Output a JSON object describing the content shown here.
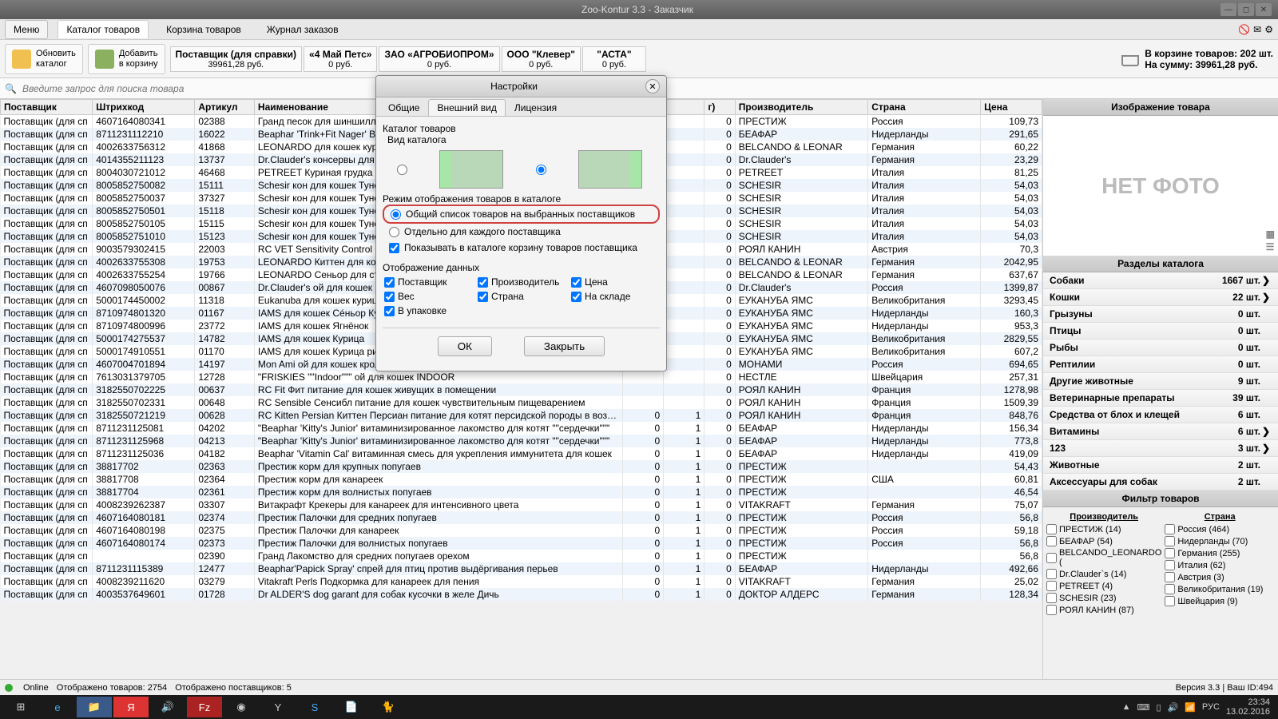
{
  "titlebar": {
    "title": "Zoo-Kontur 3.3 - Заказчик"
  },
  "menu": {
    "button": "Меню",
    "tabs": [
      "Каталог товаров",
      "Корзина товаров",
      "Журнал заказов"
    ]
  },
  "toolbar": {
    "refresh": "Обновить\nкаталог",
    "add": "Добавить\nв корзину",
    "suppliers": [
      {
        "name": "Поставщик (для справки)",
        "value": "39961,28 руб."
      },
      {
        "name": "«4 Май Петс»",
        "value": "0 руб."
      },
      {
        "name": "ЗАО «АГРОБИОПРОМ»",
        "value": "0 руб."
      },
      {
        "name": "ООО \"Клевер\"",
        "value": "0 руб."
      },
      {
        "name": "\"АСТА\"",
        "value": "0 руб."
      }
    ],
    "cart_items": "В корзине товаров: 202 шт.",
    "cart_sum": "На сумму: 39961,28 руб."
  },
  "search": {
    "placeholder": "Введите запрос для поиска товара"
  },
  "columns": [
    "Поставщик",
    "Штрихкод",
    "Артикул",
    "Наименование",
    "",
    "",
    "",
    "Производитель",
    "Страна",
    "Цена"
  ],
  "col_extra_g": "г)",
  "rows": [
    [
      "Поставщик (для сп",
      "4607164080341",
      "02388",
      "Гранд песок для шиншилл",
      "",
      "",
      "0",
      "ПРЕСТИЖ",
      "Россия",
      "109,73"
    ],
    [
      "Поставщик (для сп",
      "8711231112210",
      "16022",
      "Beaphar 'Trink+Fit Nager' Витамины для грызунов",
      "",
      "",
      "0",
      "БЕАФАР",
      "Нидерланды",
      "291,65"
    ],
    [
      "Поставщик (для сп",
      "4002633756312",
      "41868",
      "LEONARDO для кошек курицей",
      "",
      "",
      "0",
      "BELCANDO & LEONAR",
      "Германия",
      "60,22"
    ],
    [
      "Поставщик (для сп",
      "4014355211123",
      "13737",
      "Dr.Clauder's консервы для кошек вида Домашняя",
      "",
      "",
      "0",
      "Dr.Clauder's",
      "Германия",
      "23,29"
    ],
    [
      "Поставщик (для сп",
      "8004030721012",
      "46468",
      "PETREET Куриная грудка",
      "",
      "",
      "0",
      "PETREET",
      "Италия",
      "81,25"
    ],
    [
      "Поставщик (для сп",
      "8005852750082",
      "15111",
      "Schesir кон для кошек Тунец морскими водорослями",
      "",
      "",
      "0",
      "SCHESIR",
      "Италия",
      "54,03"
    ],
    [
      "Поставщик (для сп",
      "8005852750037",
      "37327",
      "Schesir кон для кошек Тунец Мальки",
      "",
      "",
      "0",
      "SCHESIR",
      "Италия",
      "54,03"
    ],
    [
      "Поставщик (для сп",
      "8005852750501",
      "15118",
      "Schesir кон для кошек Тунец и курицей в собственном соку",
      "",
      "",
      "0",
      "SCHESIR",
      "Италия",
      "54,03"
    ],
    [
      "Поставщик (для сп",
      "8005852750105",
      "15115",
      "Schesir кон для кошек Тунец в собственном соку",
      "",
      "",
      "0",
      "SCHESIR",
      "Италия",
      "54,03"
    ],
    [
      "Поставщик (для сп",
      "8005852751010",
      "15123",
      "Schesir кон для кошек Тунец",
      "",
      "",
      "0",
      "SCHESIR",
      "Италия",
      "54,03"
    ],
    [
      "Поставщик (для сп",
      "9003579302415",
      "22003",
      "RC VET Sensitivity Control Сенситив контроль",
      "",
      "",
      "0",
      "РОЯЛ КАНИН",
      "Австрия",
      "70,3"
    ],
    [
      "Поставщик (для сп",
      "4002633755308",
      "19753",
      "LEONARDO Киттен для котят для беременных",
      "",
      "",
      "0",
      "BELCANDO & LEONAR",
      "Германия",
      "2042,95"
    ],
    [
      "Поставщик (для сп",
      "4002633755254",
      "19766",
      "LEONARDO Сеньор для стареющих кошек",
      "",
      "",
      "0",
      "BELCANDO & LEONAR",
      "Германия",
      "637,67"
    ],
    [
      "Поставщик (для сп",
      "4607098050076",
      "00867",
      "Dr.Clauder's ой для кошек Мясное Ассорти",
      "",
      "",
      "0",
      "Dr.Clauder's",
      "Россия",
      "1399,87"
    ],
    [
      "Поставщик (для сп",
      "5000174450002",
      "11318",
      "Eukanuba для кошек курицей и ливер",
      "",
      "",
      "0",
      "ЕУКАНУБА ЯМС",
      "Великобритания",
      "3293,45"
    ],
    [
      "Поставщик (для сп",
      "8710974801320",
      "01167",
      "IAMS для кошек Сéньор Курица рисом",
      "",
      "",
      "0",
      "ЕУКАНУБА ЯМС",
      "Нидерланды",
      "160,3"
    ],
    [
      "Поставщик (для сп",
      "8710974800996",
      "23772",
      "IAMS для кошек Ягнёнок",
      "",
      "",
      "0",
      "ЕУКАНУБА ЯМС",
      "Нидерланды",
      "953,3"
    ],
    [
      "Поставщик (для сп",
      "5000174275537",
      "14782",
      "IAMS для кошек Курица",
      "",
      "",
      "0",
      "ЕУКАНУБА ЯМС",
      "Великобритания",
      "2829,55"
    ],
    [
      "Поставщик (для сп",
      "5000174910551",
      "01170",
      "IAMS для кошек Курица рисом",
      "",
      "",
      "0",
      "ЕУКАНУБА ЯМС",
      "Великобритания",
      "607,2"
    ],
    [
      "Поставщик (для сп",
      "4607004701894",
      "14197",
      "Mon Ami ой для кошек кролик МКБ",
      "",
      "",
      "0",
      "МОНАМИ",
      "Россия",
      "694,65"
    ],
    [
      "Поставщик (для сп",
      "7613031379705",
      "12728",
      "\"FRISKIES \"\"Indoor\"\"\" ой для кошек INDOOR",
      "",
      "",
      "0",
      "НЕСТЛЕ",
      "Швейцария",
      "257,31"
    ],
    [
      "Поставщик (для сп",
      "3182550702225",
      "00637",
      "RC Fit Фит питание для кошек живущих в помещении",
      "",
      "",
      "0",
      "РОЯЛ КАНИН",
      "Франция",
      "1278,98"
    ],
    [
      "Поставщик (для сп",
      "3182550702331",
      "00648",
      "RC Sensible Сенсибл питание для кошек чувствительным пищеварением",
      "",
      "",
      "0",
      "РОЯЛ КАНИН",
      "Франция",
      "1509,39"
    ],
    [
      "Поставщик (для сп",
      "3182550721219",
      "00628",
      "RC Kitten Persian Киттен Персиан питание для котят персидской породы в возрасте",
      "0",
      "1",
      "0",
      "РОЯЛ КАНИН",
      "Франция",
      "848,76"
    ],
    [
      "Поставщик (для сп",
      "8711231125081",
      "04202",
      "\"Beaphar 'Kitty's Junior' витаминизированное лакомство для котят \"\"сердечки\"\"\"",
      "0",
      "1",
      "0",
      "БЕАФАР",
      "Нидерланды",
      "156,34"
    ],
    [
      "Поставщик (для сп",
      "8711231125968",
      "04213",
      "\"Beaphar 'Kitty's Junior' витаминизированное лакомство для котят \"\"сердечки\"\"\"",
      "0",
      "1",
      "0",
      "БЕАФАР",
      "Нидерланды",
      "773,8"
    ],
    [
      "Поставщик (для сп",
      "8711231125036",
      "04182",
      "Beaphar 'Vitamin Cal' витаминная смесь для укрепления иммунитета для кошек",
      "0",
      "1",
      "0",
      "БЕАФАР",
      "Нидерланды",
      "419,09"
    ],
    [
      "Поставщик (для сп",
      "38817702",
      "02363",
      "Престиж корм для крупных попугаев",
      "0",
      "1",
      "0",
      "ПРЕСТИЖ",
      "",
      "54,43"
    ],
    [
      "Поставщик (для сп",
      "38817708",
      "02364",
      "Престиж корм для канареек",
      "0",
      "1",
      "0",
      "ПРЕСТИЖ",
      "США",
      "60,81"
    ],
    [
      "Поставщик (для сп",
      "38817704",
      "02361",
      "Престиж корм для волнистых попугаев",
      "0",
      "1",
      "0",
      "ПРЕСТИЖ",
      "",
      "46,54"
    ],
    [
      "Поставщик (для сп",
      "4008239262387",
      "03307",
      "Витакрафт Крекеры для канареек для интенсивного цвета",
      "0",
      "1",
      "0",
      "VITAKRAFT",
      "Германия",
      "75,07"
    ],
    [
      "Поставщик (для сп",
      "4607164080181",
      "02374",
      "Престиж Палочки для средних попугаев",
      "0",
      "1",
      "0",
      "ПРЕСТИЖ",
      "Россия",
      "56,8"
    ],
    [
      "Поставщик (для сп",
      "4607164080198",
      "02375",
      "Престиж Палочки для канареек",
      "0",
      "1",
      "0",
      "ПРЕСТИЖ",
      "Россия",
      "59,18"
    ],
    [
      "Поставщик (для сп",
      "4607164080174",
      "02373",
      "Престиж Палочки для волнистых попугаев",
      "0",
      "1",
      "0",
      "ПРЕСТИЖ",
      "Россия",
      "56,8"
    ],
    [
      "Поставщик (для сп",
      "",
      "02390",
      "Гранд Лакомство для средних попугаев орехом",
      "0",
      "1",
      "0",
      "ПРЕСТИЖ",
      "",
      "56,8"
    ],
    [
      "Поставщик (для сп",
      "8711231115389",
      "12477",
      "Beaphar'Papick Spray' спрей для птиц против выдёргивания перьев",
      "0",
      "1",
      "0",
      "БЕАФАР",
      "Нидерланды",
      "492,66"
    ],
    [
      "Поставщик (для сп",
      "4008239211620",
      "03279",
      "Vitakraft Perls Подкормка для канареек для пения",
      "0",
      "1",
      "0",
      "VITAKRAFT",
      "Германия",
      "25,02"
    ],
    [
      "Поставщик (для сп",
      "4003537649601",
      "01728",
      "Dr ALDER'S dog garant для собак кусочки в желе Дичь",
      "0",
      "1",
      "0",
      "ДОКТОР АЛДЕРС",
      "Германия",
      "128,34"
    ]
  ],
  "rightpanel": {
    "img_title": "Изображение товара",
    "no_photo": "НЕТ ФОТО",
    "cat_title": "Разделы каталога",
    "categories": [
      {
        "n": "Собаки",
        "c": "1667 шт.",
        "a": "❯"
      },
      {
        "n": "Кошки",
        "c": "22 шт.",
        "a": "❯"
      },
      {
        "n": "Грызуны",
        "c": "0 шт.",
        "a": ""
      },
      {
        "n": "Птицы",
        "c": "0 шт.",
        "a": ""
      },
      {
        "n": "Рыбы",
        "c": "0 шт.",
        "a": ""
      },
      {
        "n": "Рептилии",
        "c": "0 шт.",
        "a": ""
      },
      {
        "n": "Другие животные",
        "c": "9 шт.",
        "a": ""
      },
      {
        "n": "Ветеринарные препараты",
        "c": "39 шт.",
        "a": ""
      },
      {
        "n": "Средства от блох и клещей",
        "c": "6 шт.",
        "a": ""
      },
      {
        "n": "Витамины",
        "c": "6 шт.",
        "a": "❯"
      },
      {
        "n": "123",
        "c": "3 шт.",
        "a": "❯"
      },
      {
        "n": "Животные",
        "c": "2 шт.",
        "a": ""
      },
      {
        "n": "Аксессуары для собак",
        "c": "2 шт.",
        "a": ""
      }
    ],
    "filter_title": "Фильтр товаров",
    "filter_mfr": "Производитель",
    "filter_country": "Страна",
    "mfrs": [
      "ПРЕСТИЖ (14)",
      "БЕАФАР (54)",
      "BELCANDO_LEONARDO (",
      "Dr.Clauder`s (14)",
      "PETREET (4)",
      "SCHESIR (23)",
      "РОЯЛ КАНИН (87)"
    ],
    "countries": [
      "Россия (464)",
      "Нидерланды (70)",
      "Германия (255)",
      "Италия (62)",
      "Австрия (3)",
      "Великобритания (19)",
      "Швейцария (9)"
    ]
  },
  "status": {
    "online": "Online",
    "items": "Отображено товаров: 2754",
    "sup": "Отображено поставщиков: 5",
    "ver": "Версия 3.3",
    "id": "Ваш ID:494"
  },
  "dialog": {
    "title": "Настройки",
    "tabs": [
      "Общие",
      "Внешний вид",
      "Лицензия"
    ],
    "grp1": "Каталог товаров",
    "grp1_sub": "Вид каталога",
    "grp2": "Режим отображения товаров в каталоге",
    "r1": "Общий список товаров на выбранных поставщиков",
    "r2": "Отдельно для каждого поставщика",
    "chk_cart": "Показывать в каталоге корзину товаров поставщика",
    "grp3": "Отображение данных",
    "opts": [
      "Поставщик",
      "Производитель",
      "Цена",
      "Вес",
      "Страна",
      "На складе",
      "В упаковке"
    ],
    "ok": "ОК",
    "close": "Закрыть"
  },
  "tray": {
    "lang": "РУС",
    "time": "23:34",
    "date": "13.02.2016"
  }
}
